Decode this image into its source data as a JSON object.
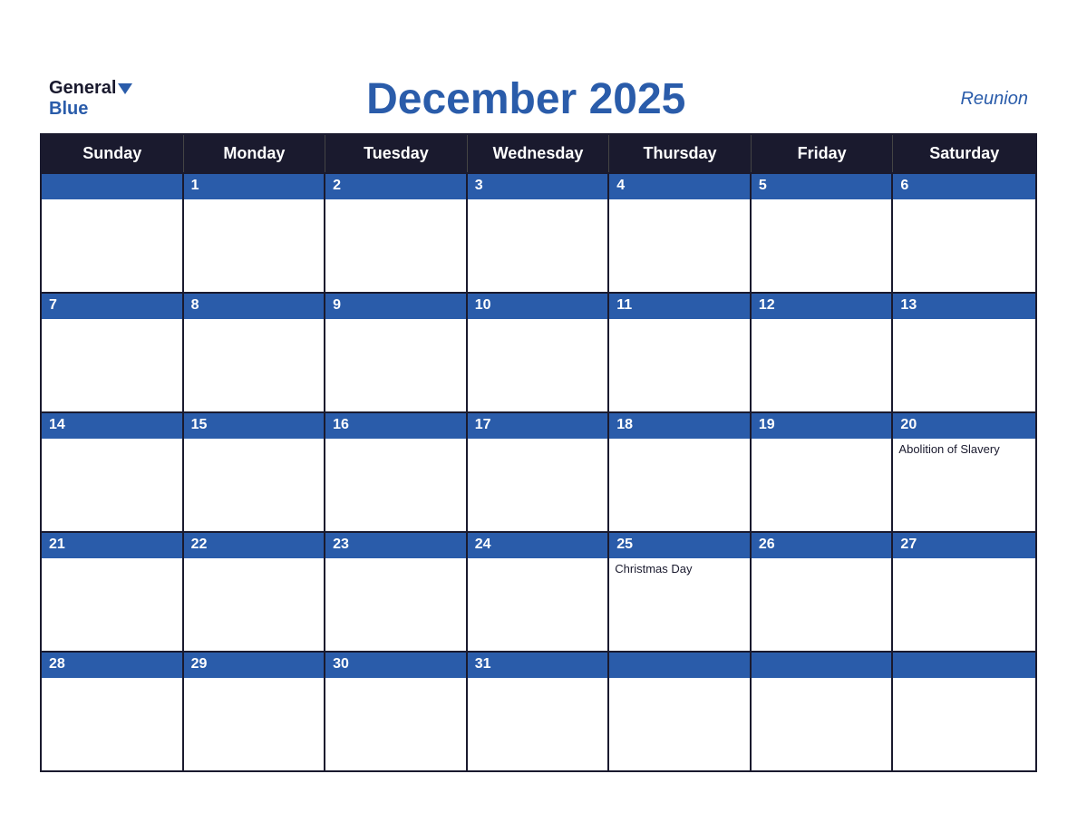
{
  "header": {
    "logo_general": "General",
    "logo_blue": "Blue",
    "title": "December 2025",
    "region": "Reunion"
  },
  "days_of_week": [
    "Sunday",
    "Monday",
    "Tuesday",
    "Wednesday",
    "Thursday",
    "Friday",
    "Saturday"
  ],
  "weeks": [
    [
      {
        "number": "",
        "empty": true
      },
      {
        "number": "1",
        "empty": false
      },
      {
        "number": "2",
        "empty": false
      },
      {
        "number": "3",
        "empty": false
      },
      {
        "number": "4",
        "empty": false
      },
      {
        "number": "5",
        "empty": false
      },
      {
        "number": "6",
        "empty": false
      }
    ],
    [
      {
        "number": "7",
        "empty": false
      },
      {
        "number": "8",
        "empty": false
      },
      {
        "number": "9",
        "empty": false
      },
      {
        "number": "10",
        "empty": false
      },
      {
        "number": "11",
        "empty": false
      },
      {
        "number": "12",
        "empty": false
      },
      {
        "number": "13",
        "empty": false
      }
    ],
    [
      {
        "number": "14",
        "empty": false
      },
      {
        "number": "15",
        "empty": false
      },
      {
        "number": "16",
        "empty": false
      },
      {
        "number": "17",
        "empty": false
      },
      {
        "number": "18",
        "empty": false
      },
      {
        "number": "19",
        "empty": false
      },
      {
        "number": "20",
        "empty": false,
        "event": "Abolition of Slavery"
      }
    ],
    [
      {
        "number": "21",
        "empty": false
      },
      {
        "number": "22",
        "empty": false
      },
      {
        "number": "23",
        "empty": false
      },
      {
        "number": "24",
        "empty": false
      },
      {
        "number": "25",
        "empty": false,
        "event": "Christmas Day"
      },
      {
        "number": "26",
        "empty": false
      },
      {
        "number": "27",
        "empty": false
      }
    ],
    [
      {
        "number": "28",
        "empty": false
      },
      {
        "number": "29",
        "empty": false
      },
      {
        "number": "30",
        "empty": false
      },
      {
        "number": "31",
        "empty": false
      },
      {
        "number": "",
        "empty": true
      },
      {
        "number": "",
        "empty": true
      },
      {
        "number": "",
        "empty": true
      }
    ]
  ]
}
